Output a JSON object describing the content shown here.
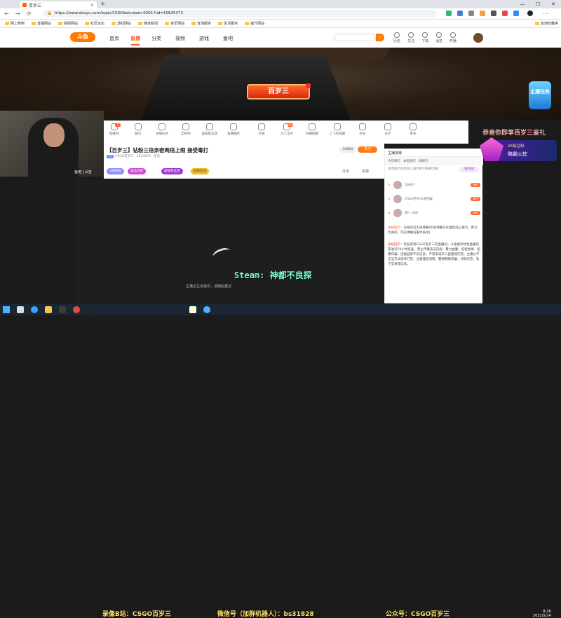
{
  "browser": {
    "tab_title": "百岁三",
    "url": "https://www.douyu.com/topic/CSGObaisuisan-0301?rid=10625373",
    "bookmarks": [
      "网上购物",
      "直播网站",
      "视频网站",
      "社区论坛",
      "游戏网站",
      "媒体新闻",
      "资讯网站",
      "查询服务",
      "生活服务",
      "提升网站"
    ],
    "bookmarks_right": "其他收藏夹"
  },
  "site": {
    "logo": "斗鱼",
    "nav": [
      "首页",
      "直播",
      "分类",
      "视频",
      "游戏",
      "鱼吧"
    ],
    "active_nav": "直播",
    "search_placeholder": "",
    "header_icons": [
      "历史",
      "关注",
      "下载",
      "消息",
      "开播"
    ]
  },
  "banner": {
    "streamer_badge": "百岁三",
    "task_badge": "主播任务"
  },
  "webcam": {
    "label": "鱼吧 | 公告"
  },
  "toolbar": [
    {
      "label": "直播PK",
      "badge": "2"
    },
    {
      "label": "翻页"
    },
    {
      "label": "主播任务"
    },
    {
      "label": "全民PK"
    },
    {
      "label": "超级粉丝团"
    },
    {
      "label": "直播抽奖"
    },
    {
      "label": "礼物"
    },
    {
      "label": "大八全开",
      "badge": "new"
    },
    {
      "label": "开播提醒"
    },
    {
      "label": "上飞机提醒"
    },
    {
      "label": "抄号"
    },
    {
      "label": "分享"
    },
    {
      "label": "更多"
    }
  ],
  "room": {
    "title": "【百岁三】钻粉三倍亲密两倍上限 接受毒打",
    "level": "V1",
    "meta": "CSGO百岁三 · 1024878 · 首页",
    "fans": "20684",
    "follow": "关注",
    "tags": [
      "V丽丽姬",
      "极品闪亮",
      "超级粉丝团",
      "钻粉房间"
    ],
    "share": "分享",
    "report": "举报"
  },
  "player": {
    "loading_text": "主播正在加速中，请稍后重试",
    "overlay_steam": "Steam: 神都不良探"
  },
  "chat": {
    "tab": "主播排榜",
    "sub_tabs": [
      "今日排行",
      "本周排行",
      "周排行"
    ],
    "note": "本周排行连续排上排行榜可解锁宝箱",
    "note_btn": "成为前",
    "ranks": [
      {
        "name": "50807",
        "badge": "周榜"
      },
      {
        "name": "CSGO百岁三的回复",
        "badge": "周榜"
      },
      {
        "name": "情一 228",
        "badge": "周榜"
      }
    ],
    "sys1_label": "系统提示：",
    "sys1": "已经开启历史弹幕(历史弹幕只在播出前上展示，默认为关闭，可在弹幕设置中关闭)",
    "sys2_label": "系统提示：",
    "sys2": "欢迎来到CSGO百岁三的直播间，斗鱼倡导绿色直播内容进行24小时巡查，禁止传播违法违规、暴力血腥、低俗色情、招嫖诈骗、违规品牌不良信息，严禁未成年人直播或打赏。主播以不正当方式诱导打赏，注意理性消费，警惕网络诈骗，代练代充、私下交易等信息。"
  },
  "gift_panel": {
    "headline": "恭喜你即享百岁三豪礼",
    "level": "28级钻粉",
    "name": "略霸火蛇"
  },
  "taskbar": {
    "overlay_bili": "录像B站：CSGO百岁三",
    "overlay_wx": "微信号（加群机器人）：bs31828",
    "overlay_gzh": "公众号：CSGO百岁三",
    "time": "8:26",
    "date": "2022/5/24"
  },
  "colors": {
    "accent": "#ff5d23",
    "follow": "#ff7a1c"
  }
}
